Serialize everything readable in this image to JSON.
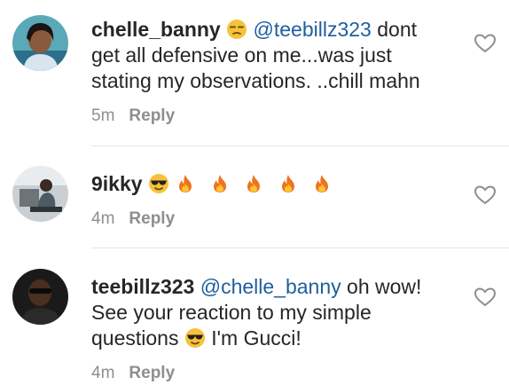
{
  "comments": [
    {
      "username": "chelle_banny",
      "mention": "@teebillz323",
      "text": "dont get all defensive on me...was just stating my observations. ..chill mahn",
      "time": "5m",
      "reply_label": "Reply"
    },
    {
      "username": "9ikky",
      "mention": "",
      "text": "",
      "time": "4m",
      "reply_label": "Reply"
    },
    {
      "username": "teebillz323",
      "mention": "@chelle_banny",
      "text_before_emoji": "oh wow! See your reaction to my simple questions",
      "text_after_emoji": "I'm Gucci!",
      "time": "4m",
      "reply_label": "Reply"
    }
  ],
  "icons": {
    "like": "heart-outline-icon",
    "emoji_unamused": "unamused-face-emoji",
    "emoji_sunglasses": "sunglasses-face-emoji",
    "emoji_fire": "fire-emoji"
  },
  "colors": {
    "mention": "#1f5f9e",
    "meta": "#8e8e8e",
    "text": "#262626"
  }
}
